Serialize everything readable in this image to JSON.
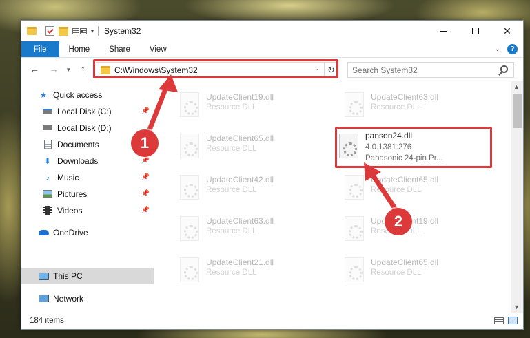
{
  "window": {
    "title": "System32",
    "controls": {
      "minimize": "minimize-icon",
      "maximize": "maximize-icon",
      "close": "✕"
    }
  },
  "ribbon": {
    "tabs": [
      "File",
      "Home",
      "Share",
      "View"
    ],
    "help": "?"
  },
  "nav": {
    "address": "C:\\Windows\\System32",
    "search_placeholder": "Search System32"
  },
  "sidebar": {
    "items": [
      {
        "label": "Quick access",
        "icon": "star-icon"
      },
      {
        "label": "Local Disk (C:)",
        "icon": "drive-c-icon",
        "pinned": true
      },
      {
        "label": "Local Disk (D:)",
        "icon": "drive-d-icon"
      },
      {
        "label": "Documents",
        "icon": "documents-icon",
        "pinned": true
      },
      {
        "label": "Downloads",
        "icon": "download-icon",
        "pinned": true
      },
      {
        "label": "Music",
        "icon": "music-icon",
        "pinned": true
      },
      {
        "label": "Pictures",
        "icon": "pictures-icon",
        "pinned": true
      },
      {
        "label": "Videos",
        "icon": "videos-icon",
        "pinned": true
      },
      {
        "label": "OneDrive",
        "icon": "cloud-icon"
      },
      {
        "label": "This PC",
        "icon": "monitor-icon",
        "selected": true
      },
      {
        "label": "Network",
        "icon": "network-icon"
      }
    ]
  },
  "files": [
    {
      "name": "UpdateClient19.dll",
      "type": "Resource DLL"
    },
    {
      "name": "UpdateClient63.dll",
      "type": "Resource DLL"
    },
    {
      "name": "UpdateClient65.dll",
      "type": "Resource DLL"
    },
    {
      "name": "panson24.dll",
      "version": "4.0.1381.276",
      "description": "Panasonic 24-pin Pr..."
    },
    {
      "name": "UpdateClient42.dll",
      "type": "Resource DLL"
    },
    {
      "name": "UpdateClient65.dll",
      "type": "Resource DLL"
    },
    {
      "name": "UpdateClient63.dll",
      "type": "Resource DLL"
    },
    {
      "name": "UpdateClient19.dll",
      "type": "Resource DLL"
    },
    {
      "name": "UpdateClient21.dll",
      "type": "Resource DLL"
    },
    {
      "name": "UpdateClient65.dll",
      "type": "Resource DLL"
    }
  ],
  "status": {
    "count": "184 items"
  },
  "annotations": {
    "badge1": "1",
    "badge2": "2",
    "color": "#dc3a3a"
  }
}
